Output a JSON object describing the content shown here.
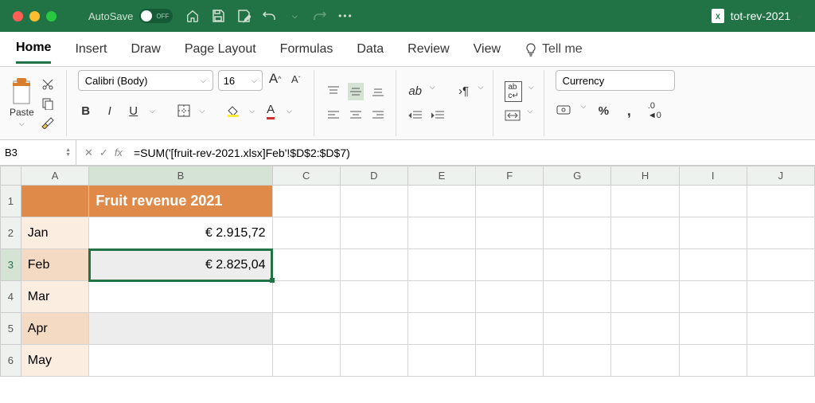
{
  "titlebar": {
    "autosave_label": "AutoSave",
    "autosave_state": "OFF",
    "filename": "tot-rev-2021"
  },
  "tabs": {
    "items": [
      "Home",
      "Insert",
      "Draw",
      "Page Layout",
      "Formulas",
      "Data",
      "Review",
      "View"
    ],
    "active": "Home",
    "tellme": "Tell me"
  },
  "ribbon": {
    "paste_label": "Paste",
    "font_name": "Calibri (Body)",
    "font_size": "16",
    "bold": "B",
    "italic": "I",
    "underline": "U",
    "number_format": "Currency"
  },
  "fbar": {
    "cellref": "B3",
    "formula": "=SUM('[fruit-rev-2021.xlsx]Feb'!$D$2:$D$7)"
  },
  "sheet": {
    "cols": [
      "A",
      "B",
      "C",
      "D",
      "E",
      "F",
      "G",
      "H",
      "I",
      "J"
    ],
    "b1": "Fruit revenue 2021",
    "rows": [
      {
        "n": 1,
        "a": "",
        "b": "Fruit revenue 2021",
        "hdr": true
      },
      {
        "n": 2,
        "a": "Jan",
        "b": "€ 2.915,72",
        "odd": true
      },
      {
        "n": 3,
        "a": "Feb",
        "b": "€ 2.825,04",
        "odd": false,
        "selected": true
      },
      {
        "n": 4,
        "a": "Mar",
        "b": "",
        "odd": true
      },
      {
        "n": 5,
        "a": "Apr",
        "b": "",
        "odd": false
      },
      {
        "n": 6,
        "a": "May",
        "b": "",
        "odd": true
      }
    ]
  }
}
